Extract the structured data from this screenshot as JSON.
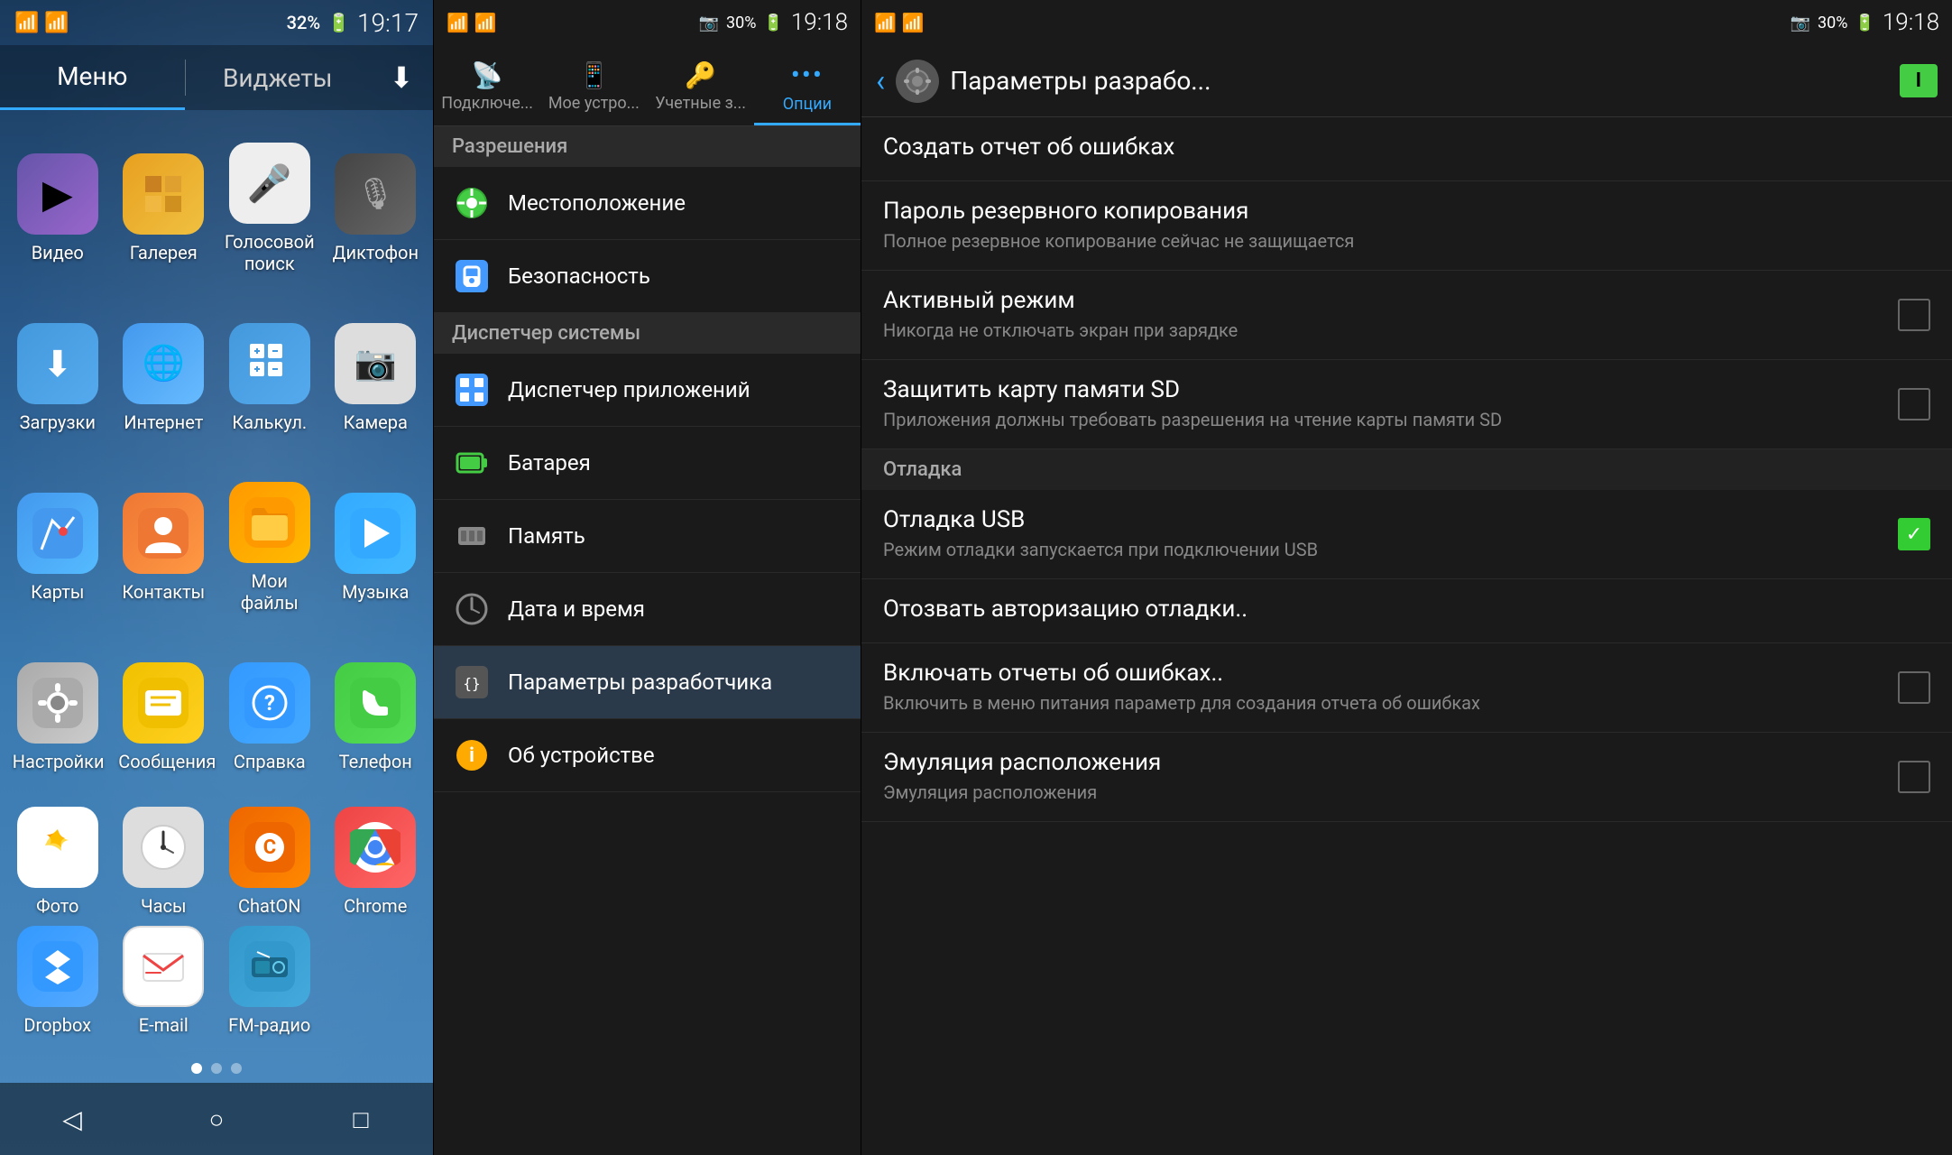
{
  "home": {
    "status": {
      "wifi": "wifi",
      "signal": "32%",
      "time": "19:17",
      "battery_icon": "🔋"
    },
    "tabs": [
      {
        "label": "Меню",
        "active": true
      },
      {
        "label": "Виджеты",
        "active": false
      }
    ],
    "apps": [
      {
        "id": "video",
        "label": "Видео",
        "icon": "▶",
        "bg": "icon-video"
      },
      {
        "id": "gallery",
        "label": "Галерея",
        "icon": "🖼",
        "bg": "icon-gallery"
      },
      {
        "id": "voice",
        "label": "Голосовой поиск",
        "icon": "🎤",
        "bg": "icon-voice"
      },
      {
        "id": "dictaphone",
        "label": "Диктофон",
        "icon": "📻",
        "bg": "icon-dictaphone"
      },
      {
        "id": "downloads",
        "label": "Загрузки",
        "icon": "⬇",
        "bg": "icon-downloads"
      },
      {
        "id": "internet",
        "label": "Интернет",
        "icon": "🌐",
        "bg": "icon-internet"
      },
      {
        "id": "calc",
        "label": "Калькул.",
        "icon": "🔢",
        "bg": "icon-calc"
      },
      {
        "id": "camera",
        "label": "Камера",
        "icon": "📷",
        "bg": "icon-camera"
      },
      {
        "id": "maps",
        "label": "Карты",
        "icon": "🗺",
        "bg": "icon-maps"
      },
      {
        "id": "contacts",
        "label": "Контакты",
        "icon": "👤",
        "bg": "icon-contacts"
      },
      {
        "id": "myfiles",
        "label": "Мои файлы",
        "icon": "📁",
        "bg": "icon-myfiles"
      },
      {
        "id": "music",
        "label": "Музыка",
        "icon": "♪",
        "bg": "icon-music"
      },
      {
        "id": "settings",
        "label": "Настройки",
        "icon": "⚙",
        "bg": "icon-settings"
      },
      {
        "id": "messages",
        "label": "Сообщения",
        "icon": "✉",
        "bg": "icon-messages"
      },
      {
        "id": "help",
        "label": "Справка",
        "icon": "?",
        "bg": "icon-help"
      },
      {
        "id": "phone",
        "label": "Телефон",
        "icon": "📞",
        "bg": "icon-phone"
      },
      {
        "id": "photos",
        "label": "Фото",
        "icon": "🌸",
        "bg": "icon-photos"
      },
      {
        "id": "clock",
        "label": "Часы",
        "icon": "🕐",
        "bg": "icon-clock"
      },
      {
        "id": "chaton",
        "label": "ChatON",
        "icon": "C",
        "bg": "icon-chaton"
      },
      {
        "id": "chrome",
        "label": "Chrome",
        "icon": "◉",
        "bg": "icon-chrome"
      },
      {
        "id": "dropbox",
        "label": "Dropbox",
        "icon": "◇",
        "bg": "icon-dropbox"
      },
      {
        "id": "email",
        "label": "E-mail",
        "icon": "✉",
        "bg": "icon-email"
      },
      {
        "id": "fmradio",
        "label": "FM-радио",
        "icon": "📻",
        "bg": "icon-fmradio"
      }
    ]
  },
  "settings": {
    "status": {
      "signal": "30%",
      "time": "19:18",
      "battery": "30%"
    },
    "tabs": [
      {
        "id": "connections",
        "label": "Подключе...",
        "icon": "📡"
      },
      {
        "id": "device",
        "label": "Мое устро...",
        "icon": "📱"
      },
      {
        "id": "accounts",
        "label": "Учетные з...",
        "icon": "🔑"
      },
      {
        "id": "options",
        "label": "Опции",
        "icon": "⋯",
        "active": true
      }
    ],
    "section_permissions": "Разрешения",
    "items": [
      {
        "id": "location",
        "label": "Местоположение",
        "icon": "◎",
        "icon_color": "#44cc44"
      },
      {
        "id": "security",
        "label": "Безопасность",
        "icon": "🔒",
        "icon_color": "#4499ff"
      },
      {
        "id": "system_manager_header",
        "label": "Диспетчер системы",
        "is_header": true
      },
      {
        "id": "app_manager",
        "label": "Диспетчер приложений",
        "icon": "▦",
        "icon_color": "#4499ff"
      },
      {
        "id": "battery",
        "label": "Батарея",
        "icon": "▮",
        "icon_color": "#44cc44"
      },
      {
        "id": "memory",
        "label": "Память",
        "icon": "▬",
        "icon_color": "#888"
      },
      {
        "id": "datetime",
        "label": "Дата и время",
        "icon": "🕐",
        "icon_color": "#888"
      },
      {
        "id": "developer",
        "label": "Параметры разработчика",
        "icon": "{}",
        "icon_color": "#888"
      },
      {
        "id": "about",
        "label": "Об устройстве",
        "icon": "ℹ",
        "icon_color": "#ffaa00"
      }
    ]
  },
  "developer": {
    "status": {
      "signal": "30%",
      "time": "19:18",
      "battery": "30%"
    },
    "header": {
      "title": "Параметры разрабо...",
      "badge": "I",
      "back_label": "‹"
    },
    "items": [
      {
        "id": "bug_report",
        "title": "Создать отчет об ошибках",
        "subtitle": "",
        "checkbox": false,
        "has_checkbox": false
      },
      {
        "id": "backup_password",
        "title": "Пароль резервного копирования",
        "subtitle": "Полное резервное копирование сейчас не защищается",
        "checkbox": false,
        "has_checkbox": false
      },
      {
        "id": "active_mode",
        "title": "Активный режим",
        "subtitle": "Никогда не отключать экран при зарядке",
        "checkbox": false,
        "has_checkbox": true
      },
      {
        "id": "protect_sd",
        "title": "Защитить карту памяти SD",
        "subtitle": "Приложения должны требовать разрешения на чтение карты памяти SD",
        "checkbox": false,
        "has_checkbox": true
      },
      {
        "id": "debug_section",
        "title": "Отладка",
        "is_section": true
      },
      {
        "id": "usb_debug",
        "title": "Отладка USB",
        "subtitle": "Режим отладки запускается при подключении USB",
        "checkbox": true,
        "has_checkbox": true
      },
      {
        "id": "revoke_debug",
        "title": "Отозвать авторизацию отладки..",
        "subtitle": "",
        "checkbox": false,
        "has_checkbox": false
      },
      {
        "id": "error_reports",
        "title": "Включать отчеты об ошибках..",
        "subtitle": "Включить в меню питания параметр для создания отчета об ошибках",
        "checkbox": false,
        "has_checkbox": true
      },
      {
        "id": "mock_location",
        "title": "Эмуляция расположения",
        "subtitle": "Эмуляция расположения",
        "checkbox": false,
        "has_checkbox": true
      }
    ]
  }
}
